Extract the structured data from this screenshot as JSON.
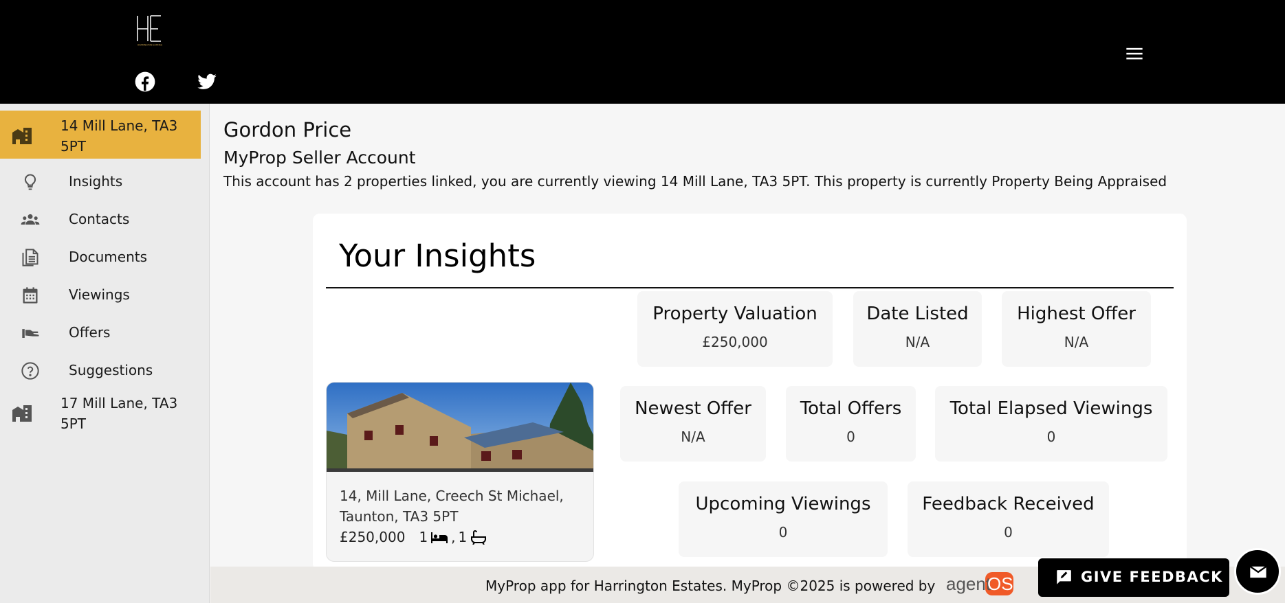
{
  "header": {
    "logo_text": "HE",
    "logo_subtitle": "HARRINGTON ESTATES",
    "social": [
      "facebook-icon",
      "twitter-icon"
    ],
    "menu_icon": "hamburger-menu-icon"
  },
  "sidebar": {
    "properties": [
      {
        "label": "14 Mill Lane, TA3 5PT",
        "icon": "building-icon",
        "active": true
      },
      {
        "label": "17 Mill Lane, TA3 5PT",
        "icon": "building-icon",
        "active": false
      }
    ],
    "items": [
      {
        "label": "Insights",
        "icon": "lightbulb-icon"
      },
      {
        "label": "Contacts",
        "icon": "people-icon"
      },
      {
        "label": "Documents",
        "icon": "documents-icon"
      },
      {
        "label": "Viewings",
        "icon": "calendar-icon"
      },
      {
        "label": "Offers",
        "icon": "offer-hand-icon"
      },
      {
        "label": "Suggestions",
        "icon": "help-circle-icon"
      }
    ],
    "active_color": "#e8b23f"
  },
  "main": {
    "owner_name": "Gordon Price",
    "account_title": "MyProp Seller Account",
    "account_description": "This account has 2 properties linked, you are currently viewing 14 Mill Lane, TA3 5PT. This property is currently Property Being Appraised"
  },
  "insights": {
    "title": "Your Insights",
    "property": {
      "address": "14, Mill Lane, Creech St Michael, Taunton, TA3 5PT",
      "price": "£250,000",
      "bedrooms": "1",
      "bathrooms": "1"
    },
    "stats": [
      {
        "label": "Property Valuation",
        "value": "£250,000"
      },
      {
        "label": "Date Listed",
        "value": "N/A"
      },
      {
        "label": "Highest Offer",
        "value": "N/A"
      },
      {
        "label": "Newest Offer",
        "value": "N/A"
      },
      {
        "label": "Total Offers",
        "value": "0"
      },
      {
        "label": "Total Elapsed Viewings",
        "value": "0"
      },
      {
        "label": "Upcoming Viewings",
        "value": "0"
      },
      {
        "label": "Feedback Received",
        "value": "0"
      }
    ]
  },
  "footer": {
    "text": "MyProp app for Harrington Estates. MyProp ©2025 is powered by",
    "brand_part1": "agent",
    "brand_part2": "OS",
    "brand_color": "#f05a28"
  },
  "feedback": {
    "label": "GIVE FEEDBACK"
  }
}
